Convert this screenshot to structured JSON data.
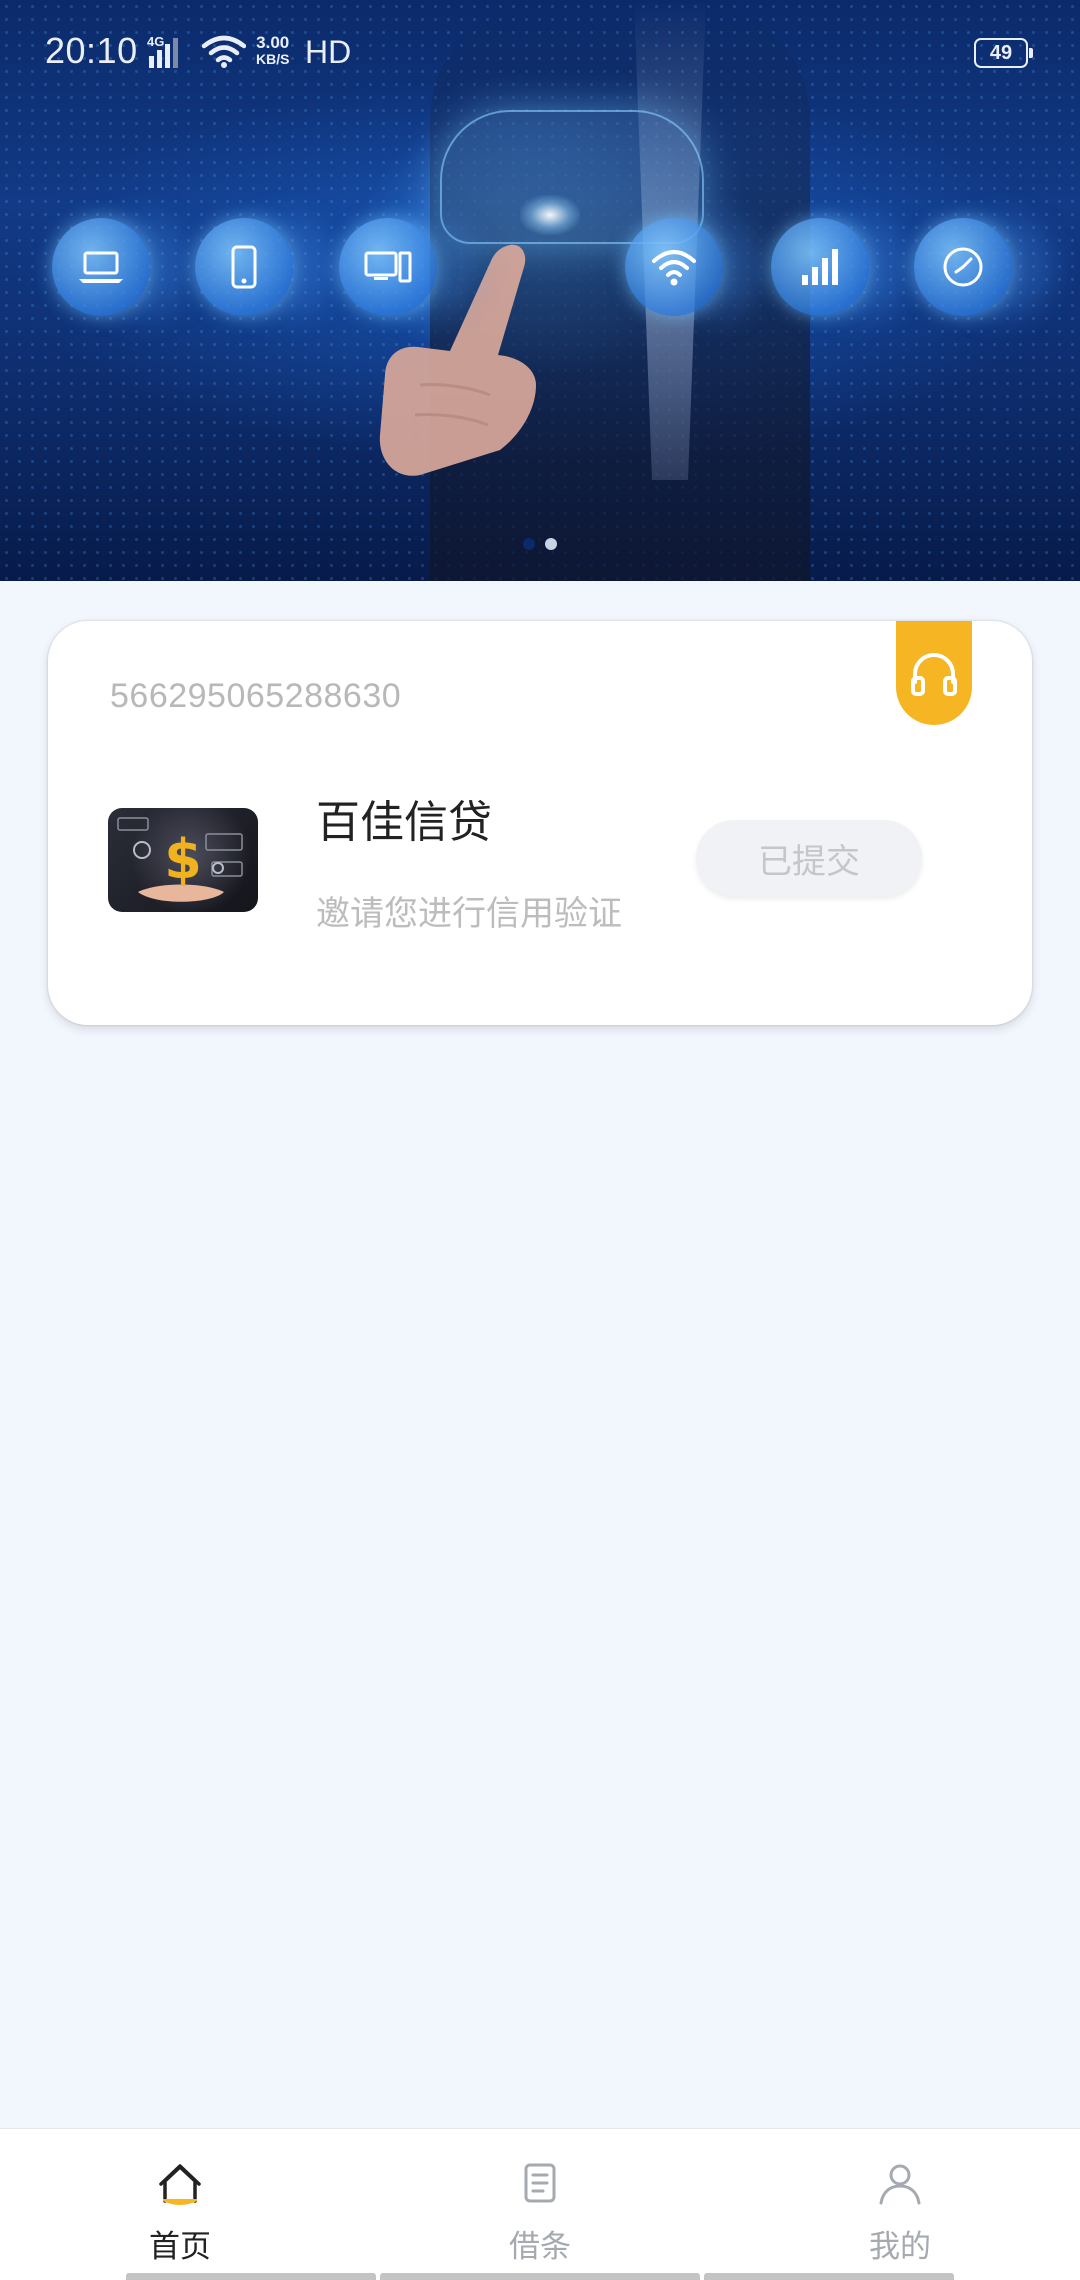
{
  "status_bar": {
    "time": "20:10",
    "network": "4G",
    "speed_value": "3.00",
    "speed_unit": "KB/S",
    "hd": "HD",
    "battery": "49"
  },
  "banner": {
    "active_slide": 2,
    "slide_count": 2,
    "icons": [
      "laptop-icon",
      "phone-icon",
      "desktop-icon",
      "wifi-icon",
      "signal-icon",
      "clock-icon"
    ],
    "colors": {
      "dot_active": "#c9d3e6",
      "dot_inactive": "#0b2a6a"
    }
  },
  "card": {
    "id_number": "566295065288630",
    "product_name": "百佳信贷",
    "product_desc": "邀请您进行信用验证",
    "button_label": "已提交",
    "support_icon": "headset-icon",
    "colors": {
      "badge": "#f6b624",
      "button_bg": "#f0f2f5",
      "button_text": "#c3c6cb"
    }
  },
  "bottom_nav": {
    "items": [
      {
        "label": "首页",
        "icon": "home-icon",
        "active": true
      },
      {
        "label": "借条",
        "icon": "document-icon",
        "active": false
      },
      {
        "label": "我的",
        "icon": "user-icon",
        "active": false
      }
    ],
    "colors": {
      "active_text": "#222222",
      "inactive_text": "#a5a9b0",
      "active_accent": "#f6b624"
    }
  }
}
